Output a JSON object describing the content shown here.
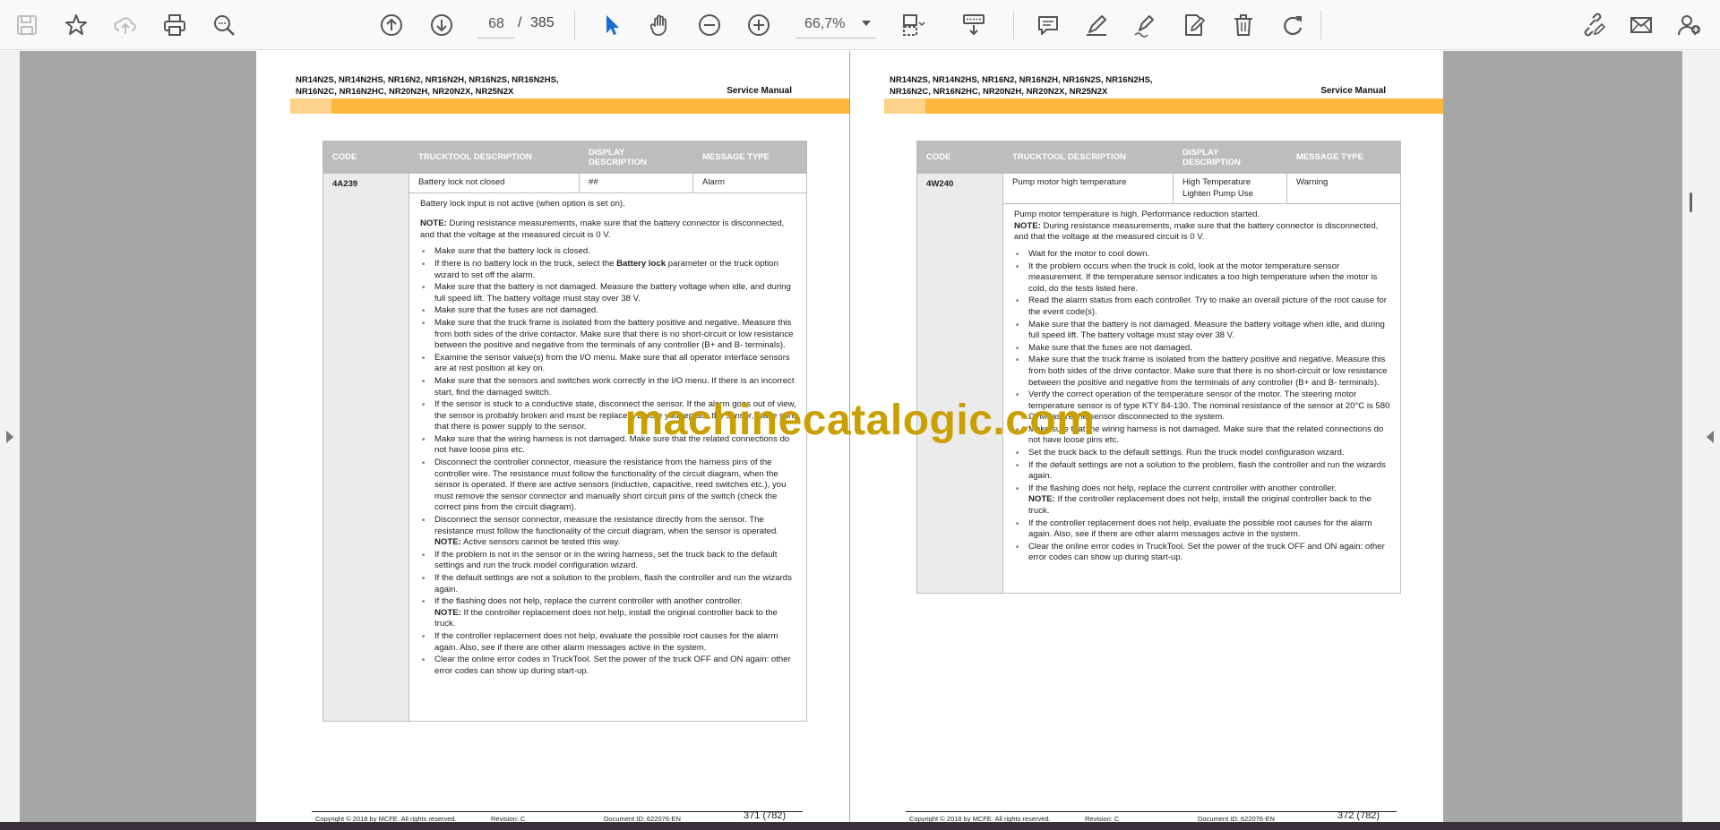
{
  "toolbar": {
    "page_current": "68",
    "page_separator": "/",
    "page_total": "385",
    "zoom": "66,7%"
  },
  "page_left": {
    "header_models_line1": "NR14N2S, NR14N2HS, NR16N2, NR16N2H, NR16N2S, NR16N2HS,",
    "header_models_line2": "NR16N2C, NR16N2HC, NR20N2H, NR20N2X, NR25N2X",
    "header_title": "Service Manual",
    "table_headers": [
      "CODE",
      "TRUCKTOOL DESCRIPTION",
      "DISPLAY DESCRIPTION",
      "MESSAGE TYPE"
    ],
    "code": "4A239",
    "trucktool_description": "Battery lock not closed",
    "display_description": "##",
    "message_type": "Alarm",
    "intro": "Battery lock input is not active (when option is set on).",
    "note_label": "NOTE:",
    "note_text": " During resistance measurements, make sure that the battery connector is disconnected, and that the voltage at the measured circuit is 0 V.",
    "steps": {
      "s1": "Make sure that the battery lock is closed.",
      "s2a": "If there is no battery lock in the truck, select the ",
      "s2b": "Battery lock",
      "s2c": " parameter or the truck option wizard to set off the alarm.",
      "s3": "Make sure that the battery is not damaged. Measure the battery voltage when idle, and during full speed lift. The battery voltage must stay over 38 V.",
      "s4": "Make sure that the fuses are not damaged.",
      "s5": "Make sure that the truck frame is isolated from the battery positive and negative. Measure this from both sides of the drive contactor. Make sure that there is no short-circuit or low resistance between the positive and negative from the terminals of any controller (B+ and B- terminals).",
      "s6": "Examine the sensor value(s) from the I/O menu. Make sure that all operator interface sensors are at rest position at key on.",
      "s7": "Make sure that the sensors and switches work correctly in the I/O menu. If there is an incorrect start, find the damaged switch.",
      "s8": "If the sensor is stuck to a conductive state, disconnect the sensor. If the alarm goes out of view, the sensor is probably broken and must be replaced. Before you replace the sensor, make sure that there is power supply to the sensor.",
      "s9": "Make sure that the wiring harness is not damaged. Make sure that the related connections do not have loose pins etc.",
      "s10": "Disconnect the controller connector, measure the resistance from the harness pins of the controller wire. The resistance must follow the functionality of the circuit diagram, when the sensor is operated. If there are active sensors (inductive, capacitive, reed switches etc.), you must remove the sensor connector and manually short circuit pins of the switch (check the correct pins from the circuit diagram).",
      "s11": "Disconnect the sensor connector, measure the resistance directly from the sensor. The resistance must follow the functionality of the circuit diagram, when the sensor is operated.",
      "s11_note_label": "NOTE:",
      "s11_note": " Active sensors cannot be tested this way.",
      "s12": "If the problem is not in the sensor or in the wiring harness, set the truck back to the default settings and run the truck model configuration wizard.",
      "s13": "If the default settings are not a solution to the problem, flash the controller and run the wizards again.",
      "s14": "If the flashing does not help, replace the current controller with another controller.",
      "s14_note_label": "NOTE:",
      "s14_note": " If the controller replacement does not help, install the original controller back to the truck.",
      "s15": "If the controller replacement does not help, evaluate the possible root causes for the alarm again. Also, see if there are other alarm messages active in the system.",
      "s16": "Clear the online error codes in TruckTool. Set the power of the truck OFF and ON again: other error codes can show up during start-up."
    },
    "footer_copyright": "Copyright © 2018 by MCFE. All rights reserved.",
    "footer_revision": "Revision: C",
    "footer_docid": "Document ID: 622076-EN",
    "footer_pagenum": "371 (782)"
  },
  "page_right": {
    "header_models_line1": "NR14N2S, NR14N2HS, NR16N2, NR16N2H, NR16N2S, NR16N2HS,",
    "header_models_line2": "NR16N2C, NR16N2HC, NR20N2H, NR20N2X, NR25N2X",
    "header_title": "Service Manual",
    "table_headers": [
      "CODE",
      "TRUCKTOOL DESCRIPTION",
      "DISPLAY DESCRIPTION",
      "MESSAGE TYPE"
    ],
    "code": "4W240",
    "trucktool_description": "Pump motor high temperature",
    "display_description_line1": "High Temperature",
    "display_description_line2": "Lighten Pump Use",
    "message_type": "Warning",
    "intro": "Pump motor temperature is high. Performance reduction started.",
    "note_label": "NOTE:",
    "note_text": " During resistance measurements, make sure that the battery connector is disconnected, and that the voltage at the measured circuit is 0 V.",
    "steps": {
      "s1": "Wait for the motor to cool down.",
      "s2": "It the problem occurs when the truck is cold, look at the motor temperature sensor measurement. If the temperature sensor indicates a too high temperature when the motor is cold, do the tests listed here.",
      "s3": "Read the alarm status from each controller. Try to make an overall picture of the root cause for the event code(s).",
      "s4": "Make sure that the battery is not damaged. Measure the battery voltage when idle, and during full speed lift. The battery voltage must stay over 38 V.",
      "s5": "Make sure that the fuses are not damaged.",
      "s6": "Make sure that the truck frame is isolated from the battery positive and negative. Measure this from both sides of the drive contactor. Make sure that there is no short-circuit or low resistance between the positive and negative from the terminals of any controller (B+ and B- terminals).",
      "s7": "Verify the correct operation of the temperature sensor of the motor. The steering motor temperature sensor is of type KTY 84-130. The nominal resistance of the sensor at 20°C is 580 Ω. Measure the sensor disconnected to the system.",
      "s8": "Make sure that the wiring harness is not damaged. Make sure that the related connections do not have loose pins etc.",
      "s9": "Set the truck back to the default settings. Run the truck model configuration wizard.",
      "s10": "If the default settings are not a solution to the problem, flash the controller and run the wizards again.",
      "s11": "If the flashing does not help, replace the current controller with another controller.",
      "s11_note_label": "NOTE:",
      "s11_note": " If the controller replacement does not help, install the original controller back to the truck.",
      "s12": "If the controller replacement does not help, evaluate the possible root causes for the alarm again. Also, see if there are other alarm messages active in the system.",
      "s13": "Clear the online error codes in TruckTool. Set the power of the truck OFF and ON again: other error codes can show up during start-up."
    },
    "footer_copyright": "Copyright © 2018 by MCFE. All rights reserved.",
    "footer_revision": "Revision: C",
    "footer_docid": "Document ID: 622076-EN",
    "footer_pagenum": "372 (782)"
  },
  "watermark": "machinecatalogic.com",
  "colors": {
    "accent_band": "#fbb83a",
    "table_header": "#bdbdbd",
    "selected_tool": "#1a6dd4",
    "watermark": "#caa000"
  }
}
